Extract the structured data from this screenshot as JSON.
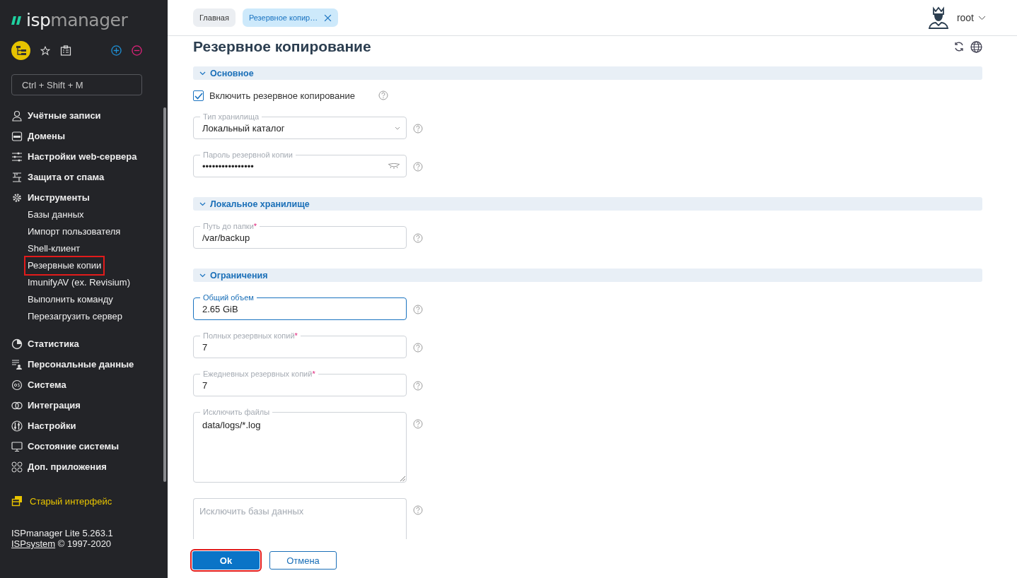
{
  "logo": {
    "part1": "isp",
    "part2": "manager"
  },
  "sidebar": {
    "search": {
      "placeholder": "Ctrl + Shift + M"
    },
    "items": [
      {
        "kind": "group",
        "label": "Учётные записи",
        "highlighted": false
      },
      {
        "kind": "group",
        "label": "Домены",
        "highlighted": false
      },
      {
        "kind": "group",
        "label": "Настройки web-сервера",
        "highlighted": false
      },
      {
        "kind": "group",
        "label": "Защита от спама",
        "highlighted": false
      },
      {
        "kind": "group",
        "label": "Инструменты",
        "highlighted": false,
        "children": [
          {
            "label": "Базы данных",
            "highlighted": false
          },
          {
            "label": "Импорт пользователя",
            "highlighted": false
          },
          {
            "label": "Shell-клиент",
            "highlighted": false
          },
          {
            "label": "Резервные копии",
            "highlighted": true
          },
          {
            "label": "ImunifyAV (ex. Revisium)",
            "highlighted": false
          },
          {
            "label": "Выполнить команду",
            "highlighted": false
          },
          {
            "label": "Перезагрузить сервер",
            "highlighted": false
          }
        ]
      },
      {
        "kind": "group",
        "label": "Статистика",
        "highlighted": false
      },
      {
        "kind": "group",
        "label": "Персональные данные",
        "highlighted": false
      },
      {
        "kind": "group",
        "label": "Система",
        "highlighted": false
      },
      {
        "kind": "group",
        "label": "Интеграция",
        "highlighted": false
      },
      {
        "kind": "group",
        "label": "Настройки",
        "highlighted": false
      },
      {
        "kind": "group",
        "label": "Состояние системы",
        "highlighted": false
      },
      {
        "kind": "group",
        "label": "Доп. приложения",
        "highlighted": false
      }
    ],
    "old_interface": "Старый интерфейс",
    "version": "ISPmanager Lite 5.263.1",
    "copyright_link": "ISPsystem",
    "copyright": " © 1997-2020"
  },
  "tabs": [
    {
      "label": "Главная",
      "selected": false,
      "closable": false
    },
    {
      "label": "Резервное копир…",
      "selected": true,
      "closable": true
    }
  ],
  "user": {
    "name": "root"
  },
  "page": {
    "title": "Резервное копирование"
  },
  "sections": [
    {
      "title": "Основное",
      "expanded": true,
      "fields": [
        {
          "kind": "checkbox",
          "label": "Включить резервное копирование",
          "checked": true
        },
        {
          "kind": "select",
          "label": "Тип хранилища",
          "value": "Локальный каталог",
          "focused": false
        },
        {
          "kind": "password",
          "label": "Пароль резервной копии",
          "value": "••••••••••••••••",
          "focused": false
        }
      ]
    },
    {
      "title": "Локальное хранилище",
      "expanded": true,
      "fields": [
        {
          "kind": "text",
          "label": "Путь до папки",
          "required_mark": "*",
          "value": "/var/backup",
          "focused": false
        }
      ]
    },
    {
      "title": "Ограничения",
      "expanded": true,
      "fields": [
        {
          "kind": "text",
          "label": "Общий объем",
          "value": "2.65 GiB",
          "focused": true
        },
        {
          "kind": "text",
          "label": "Полных резервных копий",
          "required_mark": "*",
          "value": "7",
          "focused": false
        },
        {
          "kind": "text",
          "label": "Ежедневных резервных копий",
          "required_mark": "*",
          "value": "7",
          "focused": false
        },
        {
          "kind": "textarea",
          "label": "Исключить файлы",
          "value": "data/logs/*.log",
          "focused": false
        },
        {
          "kind": "textarea",
          "placeholder": "Исключить базы данных",
          "focused": false
        }
      ]
    }
  ],
  "buttons": [
    {
      "label": "Ok",
      "kind": "primary",
      "highlighted": true
    },
    {
      "label": "Отмена",
      "kind": "secondary",
      "highlighted": false
    }
  ]
}
